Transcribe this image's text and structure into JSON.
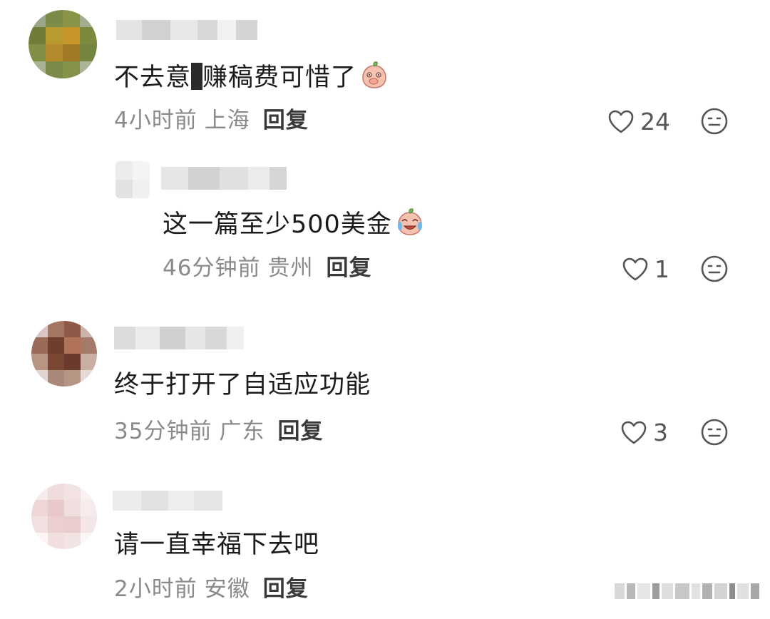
{
  "comments": [
    {
      "text_before": "不去意",
      "text_after": "赚稿费可惜了",
      "time": "4小时前",
      "location": "上海",
      "reply": "回复",
      "likes": "24"
    },
    {
      "text": "这一篇至少500美金",
      "time": "46分钟前",
      "location": "贵州",
      "reply": "回复",
      "likes": "1"
    },
    {
      "text": "终于打开了自适应功能",
      "time": "35分钟前",
      "location": "广东",
      "reply": "回复",
      "likes": "3"
    },
    {
      "text": "请一直幸福下去吧",
      "time": "2小时前",
      "location": "安徽",
      "reply": "回复"
    }
  ],
  "icons": {
    "like": "heart-outline-icon",
    "dislike": "neutral-face-icon",
    "emoji_1": "peach-covering-mouth-emoji",
    "emoji_2": "peach-crying-laughing-emoji"
  },
  "colors": {
    "meta_text": "#8a8a8a",
    "reply_text": "#3a3a3a",
    "body_text": "#1b1b1b"
  }
}
